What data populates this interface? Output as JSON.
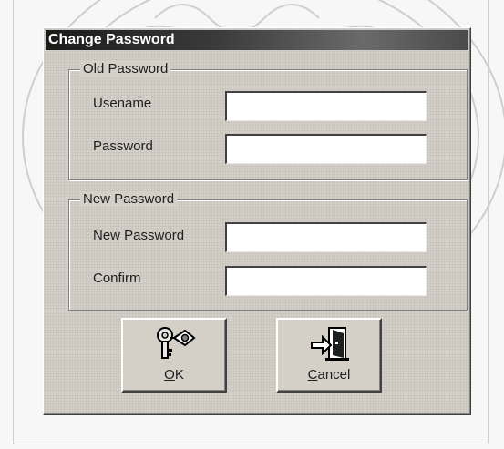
{
  "dialog": {
    "title": "Change Password",
    "old_group": {
      "legend": "Old Password",
      "username_label": "Usename",
      "username_value": "",
      "password_label": "Password",
      "password_value": ""
    },
    "new_group": {
      "legend": "New Password",
      "new_password_label": "New Password",
      "new_password_value": "",
      "confirm_label": "Confirm",
      "confirm_value": ""
    },
    "buttons": {
      "ok": {
        "mnemonic": "O",
        "rest": "K",
        "icon": "keys-icon"
      },
      "cancel": {
        "mnemonic": "C",
        "rest": "ancel",
        "icon": "exit-door-icon"
      }
    }
  },
  "colors": {
    "dialog_face": "#d4d0c8",
    "title_bar": "#1a1a1a",
    "title_text": "#ffffff"
  }
}
